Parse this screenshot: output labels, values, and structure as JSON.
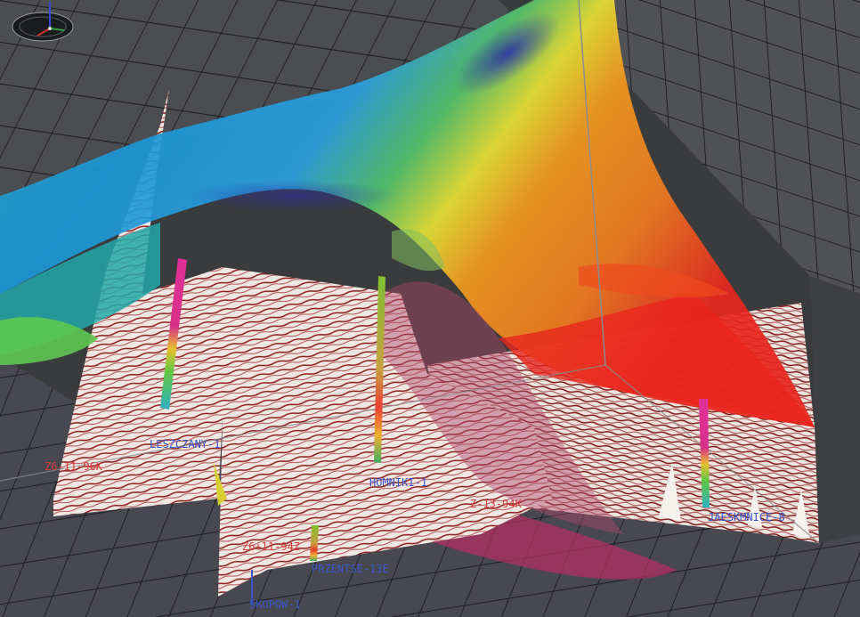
{
  "viewer": {
    "well_labels": [
      {
        "text": "LESZCZANY-1",
        "color": "#3a55c8"
      },
      {
        "text": "HOMNIKI-1",
        "color": "#3a55c8"
      },
      {
        "text": "JAESKMNICE-8",
        "color": "#3a55c8"
      },
      {
        "text": "PRZENTSE-13E",
        "color": "#3a55c8"
      },
      {
        "text": "SKOPOW-1",
        "color": "#3a55c8"
      }
    ],
    "line_labels": [
      {
        "text": "Z6-11-96K",
        "color": "#d43a3a"
      },
      {
        "text": "Z-13-94K",
        "color": "#d43a3a"
      },
      {
        "text": "Z6+11-94Z",
        "color": "#d43a3a"
      }
    ],
    "colors": {
      "background": "#3a3b3d",
      "grid_floor": "#4a4b4e",
      "grid_line": "#1e1f21",
      "horizon_low": "#1d9ad8",
      "horizon_mid": "#6bd04a",
      "horizon_high": "#f39a1e",
      "horizon_peak": "#e8261e",
      "seismic_light": "#efe9e4",
      "seismic_dark": "#8a1a1a"
    },
    "icons": [
      "orientation-compass-icon"
    ]
  }
}
